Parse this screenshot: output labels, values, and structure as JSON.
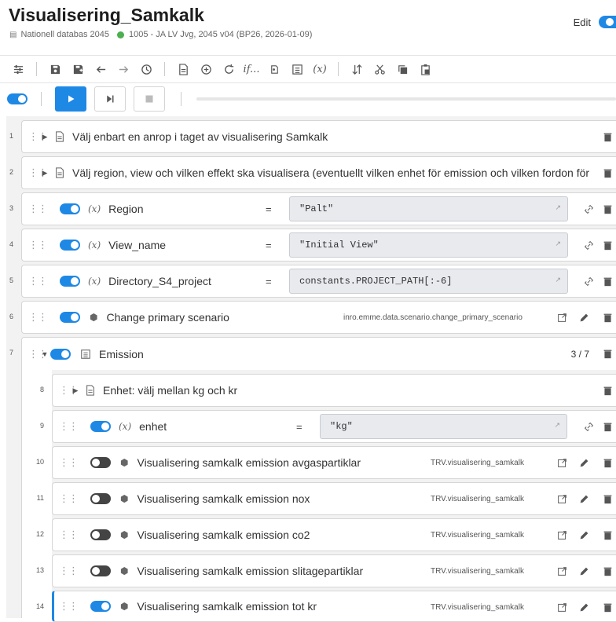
{
  "header": {
    "title": "Visualisering_Samkalk",
    "database": "Nationell databas 2045",
    "scenario": "1005 - JA LV Jvg, 2045 v04 (BP26, 2026-01-09)",
    "edit_label": "Edit"
  },
  "toolbar": {
    "variable_symbol": "(x)",
    "function_symbol": "if..."
  },
  "rows": [
    {
      "num": "1",
      "label": "Välj enbart en anrop i taget av visualisering Samkalk"
    },
    {
      "num": "2",
      "label": "Välj region, view och vilken effekt ska visualisera (eventuellt vilken enhet för emission och vilken fordon för"
    },
    {
      "num": "3",
      "var": "(x)",
      "label": "Region",
      "eq": "=",
      "value": "\"Palt\""
    },
    {
      "num": "4",
      "var": "(x)",
      "label": "View_name",
      "eq": "=",
      "value": "\"Initial View\""
    },
    {
      "num": "5",
      "var": "(x)",
      "label": "Directory_S4_project",
      "eq": "=",
      "value": "constants.PROJECT_PATH[:-6]"
    },
    {
      "num": "6",
      "label": "Change primary scenario",
      "func": "inro.emme.data.scenario.change_primary_scenario"
    },
    {
      "num": "7",
      "label": "Emission",
      "counter": "3 / 7"
    },
    {
      "num": "8",
      "label": "Enhet: välj mellan kg och kr"
    },
    {
      "num": "9",
      "var": "(x)",
      "label": "enhet",
      "eq": "=",
      "value": "\"kg\""
    },
    {
      "num": "10",
      "label": "Visualisering samkalk emission avgaspartiklar",
      "func": "TRV.visualisering_samkalk"
    },
    {
      "num": "11",
      "label": "Visualisering samkalk emission nox",
      "func": "TRV.visualisering_samkalk"
    },
    {
      "num": "12",
      "label": "Visualisering samkalk emission co2",
      "func": "TRV.visualisering_samkalk"
    },
    {
      "num": "13",
      "label": "Visualisering samkalk emission slitagepartiklar",
      "func": "TRV.visualisering_samkalk"
    },
    {
      "num": "14",
      "label": "Visualisering samkalk emission tot kr",
      "func": "TRV.visualisering_samkalk"
    }
  ],
  "colors": {
    "accent": "#1e88e5",
    "status_ok": "#4caf50",
    "toggle_off": "#444444"
  }
}
